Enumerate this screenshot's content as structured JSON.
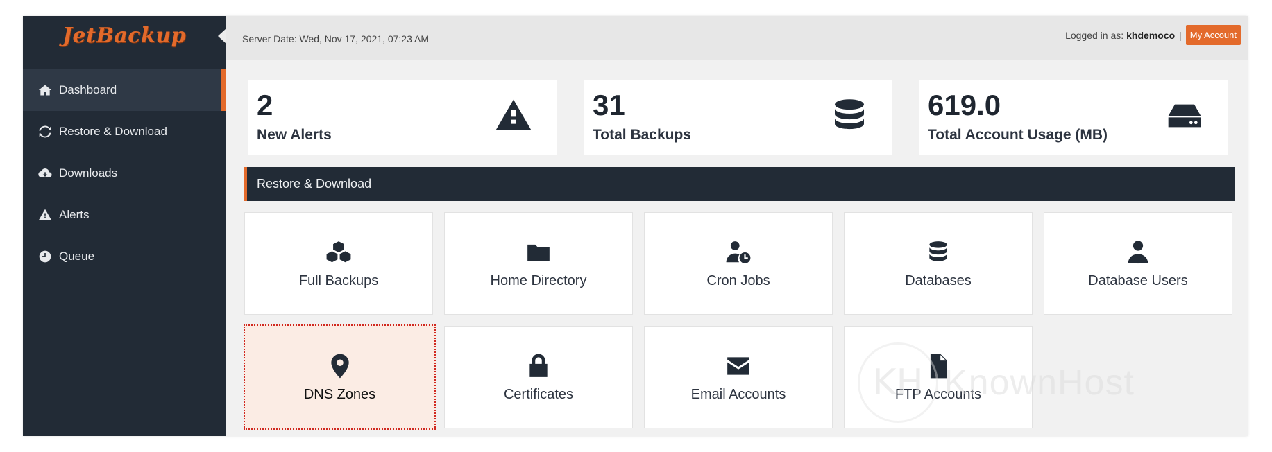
{
  "app": {
    "logo": "JetBackup"
  },
  "sidebar": {
    "items": [
      {
        "label": "Dashboard",
        "icon": "home-icon",
        "active": true
      },
      {
        "label": "Restore & Download",
        "icon": "refresh-icon",
        "active": false
      },
      {
        "label": "Downloads",
        "icon": "cloud-download-icon",
        "active": false
      },
      {
        "label": "Alerts",
        "icon": "warning-icon",
        "active": false
      },
      {
        "label": "Queue",
        "icon": "clock-icon",
        "active": false
      }
    ]
  },
  "header": {
    "server_date": "Server Date: Wed, Nov 17, 2021, 07:23 AM",
    "logged_in_prefix": "Logged in as:",
    "username": "khdemoco",
    "separator": "|",
    "my_account": "My Account"
  },
  "stats": [
    {
      "value": "2",
      "label": "New Alerts",
      "icon": "warning-icon"
    },
    {
      "value": "31",
      "label": "Total Backups",
      "icon": "database-icon"
    },
    {
      "value": "619.0",
      "label": "Total Account Usage (MB)",
      "icon": "hdd-icon"
    }
  ],
  "section": {
    "title": "Restore & Download"
  },
  "tiles": [
    {
      "label": "Full Backups",
      "icon": "cubes-icon"
    },
    {
      "label": "Home Directory",
      "icon": "folder-icon"
    },
    {
      "label": "Cron Jobs",
      "icon": "user-clock-icon"
    },
    {
      "label": "Databases",
      "icon": "database-icon"
    },
    {
      "label": "Database Users",
      "icon": "user-tie-icon"
    },
    {
      "label": "DNS Zones",
      "icon": "map-marker-icon",
      "highlighted": true
    },
    {
      "label": "Certificates",
      "icon": "lock-icon"
    },
    {
      "label": "Email Accounts",
      "icon": "envelope-icon"
    },
    {
      "label": "FTP Accounts",
      "icon": "file-icon"
    }
  ],
  "watermark": {
    "mark": "KH",
    "text": "KnownHost"
  },
  "colors": {
    "accent": "#e36a2b",
    "sidebar": "#222b36",
    "highlight_border": "#d0281f",
    "highlight_bg": "#fbece4"
  }
}
